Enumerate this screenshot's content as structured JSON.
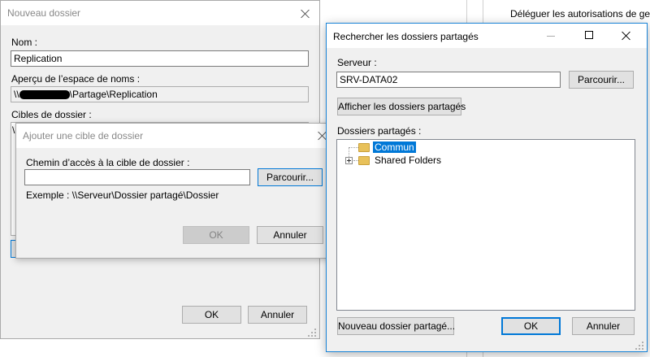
{
  "background": {
    "menu_item": "Déléguer les autorisations de ge..."
  },
  "new_folder_dialog": {
    "title": "Nouveau dossier",
    "name_label": "Nom :",
    "name_value": "Replication",
    "preview_label": "Aperçu de l’espace de noms :",
    "preview_prefix": "\\\\",
    "preview_suffix": "\\Partage\\Replication",
    "targets_label": "Cibles de dossier :",
    "targets_partial": "\\",
    "ok": "OK",
    "cancel": "Annuler"
  },
  "add_target_dialog": {
    "title": "Ajouter une cible de dossier",
    "path_label": "Chemin d’accès à la cible de dossier :",
    "path_value": "",
    "browse": "Parcourir...",
    "example": "Exemple : \\\\Serveur\\Dossier partagé\\Dossier",
    "ok": "OK",
    "cancel": "Annuler"
  },
  "browse_dialog": {
    "title": "Rechercher les dossiers partagés",
    "server_label": "Serveur :",
    "server_value": "SRV-DATA02",
    "browse": "Parcourir...",
    "show_shares": "Afficher les dossiers partagés",
    "shares_label": "Dossiers partagés :",
    "tree": [
      {
        "label": "Commun",
        "selected": true,
        "expandable": false
      },
      {
        "label": "Shared Folders",
        "selected": false,
        "expandable": true
      }
    ],
    "new_share": "Nouveau dossier partagé...",
    "ok": "OK",
    "cancel": "Annuler"
  },
  "colors": {
    "accent": "#0078d7",
    "selection": "#0078d7",
    "folder": "#e8c15a"
  }
}
